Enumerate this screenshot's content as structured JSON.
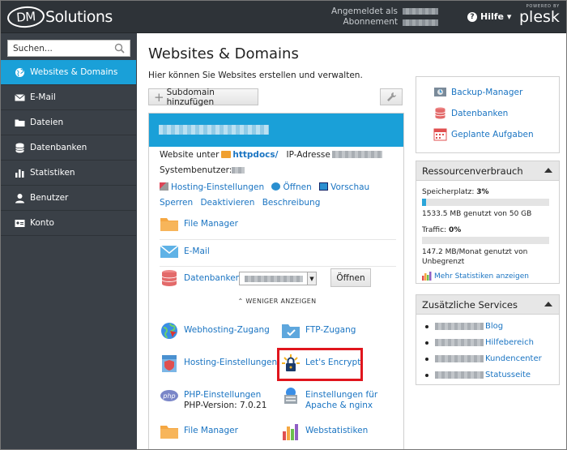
{
  "header": {
    "logo_dm": "DM",
    "logo_solutions": "Solutions",
    "logged_in_label": "Angemeldet als",
    "subscription_label": "Abonnement",
    "help_label": "Hilfe ▾",
    "powered_by": "POWERED BY",
    "plesk": "plesk"
  },
  "sidebar": {
    "search_placeholder": "Suchen...",
    "items": [
      {
        "label": "Websites & Domains",
        "icon": "globe-icon",
        "active": true
      },
      {
        "label": "E-Mail",
        "icon": "mail-icon"
      },
      {
        "label": "Dateien",
        "icon": "folder-icon"
      },
      {
        "label": "Datenbanken",
        "icon": "database-icon"
      },
      {
        "label": "Statistiken",
        "icon": "chart-icon"
      },
      {
        "label": "Benutzer",
        "icon": "user-icon"
      },
      {
        "label": "Konto",
        "icon": "id-card-icon"
      }
    ]
  },
  "main": {
    "title": "Websites & Domains",
    "subtitle": "Hier können Sie Websites erstellen und verwalten.",
    "add_subdomain": "Subdomain hinzufügen",
    "domain": {
      "website_under": "Website unter",
      "docroot": "httpdocs/",
      "ip_label": "IP-Adresse",
      "system_user": "Systembenutzer:",
      "actions": [
        "Hosting-Einstellungen",
        "Öffnen",
        "Vorschau",
        "Sperren",
        "Deaktivieren",
        "Beschreibung"
      ],
      "file_manager": "File Manager",
      "email": "E-Mail",
      "databases": "Datenbanken",
      "open_button": "Öffnen",
      "show_less": "WENIGER ANZEIGEN",
      "tiles": {
        "webhosting": "Webhosting-Zugang",
        "ftp": "FTP-Zugang",
        "hosting_settings": "Hosting-Einstellungen",
        "lets_encrypt": "Let's Encrypt",
        "php_settings": "PHP-Einstellungen",
        "php_version": "PHP-Version: 7.0.21",
        "apache_nginx_1": "Einstellungen für",
        "apache_nginx_2": "Apache & nginx",
        "file_manager": "File Manager",
        "webstats": "Webstatistiken"
      }
    }
  },
  "right": {
    "tools": [
      "Backup-Manager",
      "Datenbanken",
      "Geplante Aufgaben"
    ],
    "resources": {
      "title": "Ressourcenverbrauch",
      "disk_label": "Speicherplatz:",
      "disk_pct": "3%",
      "disk_fill": 0.03,
      "disk_text": "1533.5 MB genutzt von 50 GB",
      "traffic_label": "Traffic:",
      "traffic_pct": "0%",
      "traffic_fill": 0.0,
      "traffic_text_1": "147.2 MB/Monat genutzt von",
      "traffic_text_2": "Unbegrenzt",
      "more_stats": "Mehr Statistiken anzeigen"
    },
    "services": {
      "title": "Zusätzliche Services",
      "items": [
        "Blog",
        "Hilfebereich",
        "Kundencenter",
        "Statusseite"
      ]
    }
  },
  "colors": {
    "accent": "#1aa0d8",
    "link": "#1a74c2",
    "highlight": "#e0151d",
    "header": "#2e3338",
    "sidebar": "#3a4047"
  }
}
